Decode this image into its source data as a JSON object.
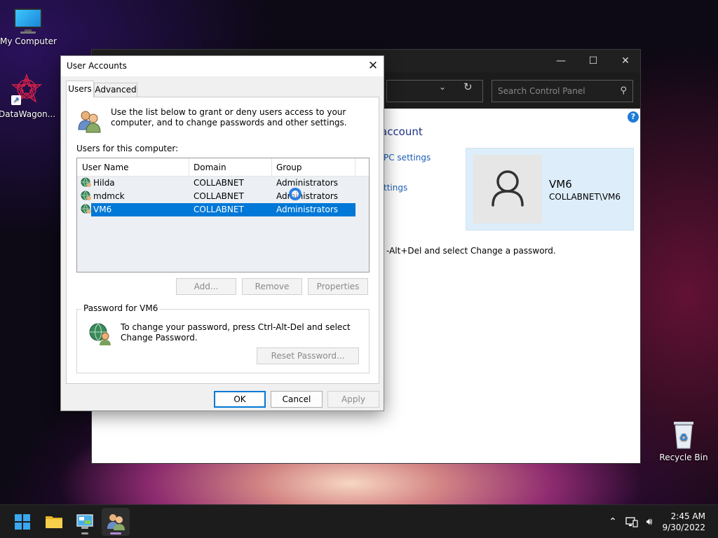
{
  "desktop": {
    "icons": [
      {
        "label": "My Computer"
      },
      {
        "label": "DataWagon..."
      },
      {
        "label": "Recycle Bin"
      }
    ]
  },
  "control_panel": {
    "search_placeholder": "Search Control Panel",
    "heading": "account",
    "links": [
      "PC settings",
      "ttings"
    ],
    "note": "-Alt+Del and select Change a password.",
    "user_name": "VM6",
    "user_sub": "COLLABNET\\VM6"
  },
  "dialog": {
    "title": "User Accounts",
    "tabs": [
      "Users",
      "Advanced"
    ],
    "intro": "Use the list below to grant or deny users access to your computer, and to change passwords and other settings.",
    "users_label": "Users for this computer:",
    "columns": [
      "User Name",
      "Domain",
      "Group"
    ],
    "rows": [
      {
        "name": "Hilda",
        "domain": "COLLABNET",
        "group": "Administrators",
        "selected": false
      },
      {
        "name": "mdmck",
        "domain": "COLLABNET",
        "group": "Administrators",
        "selected": false
      },
      {
        "name": "VM6",
        "domain": "COLLABNET",
        "group": "Administrators",
        "selected": true
      }
    ],
    "buttons": {
      "add": "Add...",
      "remove": "Remove",
      "properties": "Properties"
    },
    "password_group_title": "Password for VM6",
    "password_text": "To change your password, press Ctrl-Alt-Del and select Change Password.",
    "reset_password": "Reset Password...",
    "ok": "OK",
    "cancel": "Cancel",
    "apply": "Apply"
  },
  "taskbar": {
    "time": "2:45 AM",
    "date": "9/30/2022"
  },
  "colors": {
    "selection": "#0078d7",
    "link": "#1a5fb4",
    "taskbar": "#1c1c1c"
  }
}
